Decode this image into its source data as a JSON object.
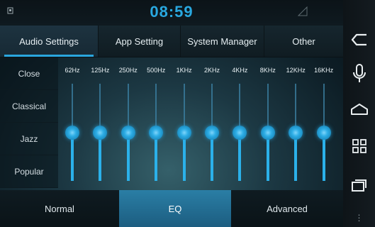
{
  "status": {
    "time": "08:59"
  },
  "tabs": [
    {
      "label": "Audio Settings",
      "active": true
    },
    {
      "label": "App Setting",
      "active": false
    },
    {
      "label": "System Manager",
      "active": false
    },
    {
      "label": "Other",
      "active": false
    }
  ],
  "presets": [
    "Close",
    "Classical",
    "Jazz",
    "Popular"
  ],
  "eq": {
    "bands": [
      {
        "freq": "62Hz",
        "level": 0.5
      },
      {
        "freq": "125Hz",
        "level": 0.5
      },
      {
        "freq": "250Hz",
        "level": 0.5
      },
      {
        "freq": "500Hz",
        "level": 0.5
      },
      {
        "freq": "1KHz",
        "level": 0.5
      },
      {
        "freq": "2KHz",
        "level": 0.5
      },
      {
        "freq": "4KHz",
        "level": 0.5
      },
      {
        "freq": "8KHz",
        "level": 0.5
      },
      {
        "freq": "12KHz",
        "level": 0.5
      },
      {
        "freq": "16KHz",
        "level": 0.5
      }
    ]
  },
  "modes": [
    {
      "label": "Normal",
      "active": false
    },
    {
      "label": "EQ",
      "active": true
    },
    {
      "label": "Advanced",
      "active": false
    }
  ],
  "nav": {
    "icons": [
      "back-icon",
      "microphone-icon",
      "home-icon",
      "apps-grid-icon",
      "recent-apps-icon",
      "menu-dots-icon"
    ]
  },
  "colors": {
    "accent": "#2aa6de",
    "clock": "#29a8e0",
    "active_mode": "#2a7ea5"
  }
}
